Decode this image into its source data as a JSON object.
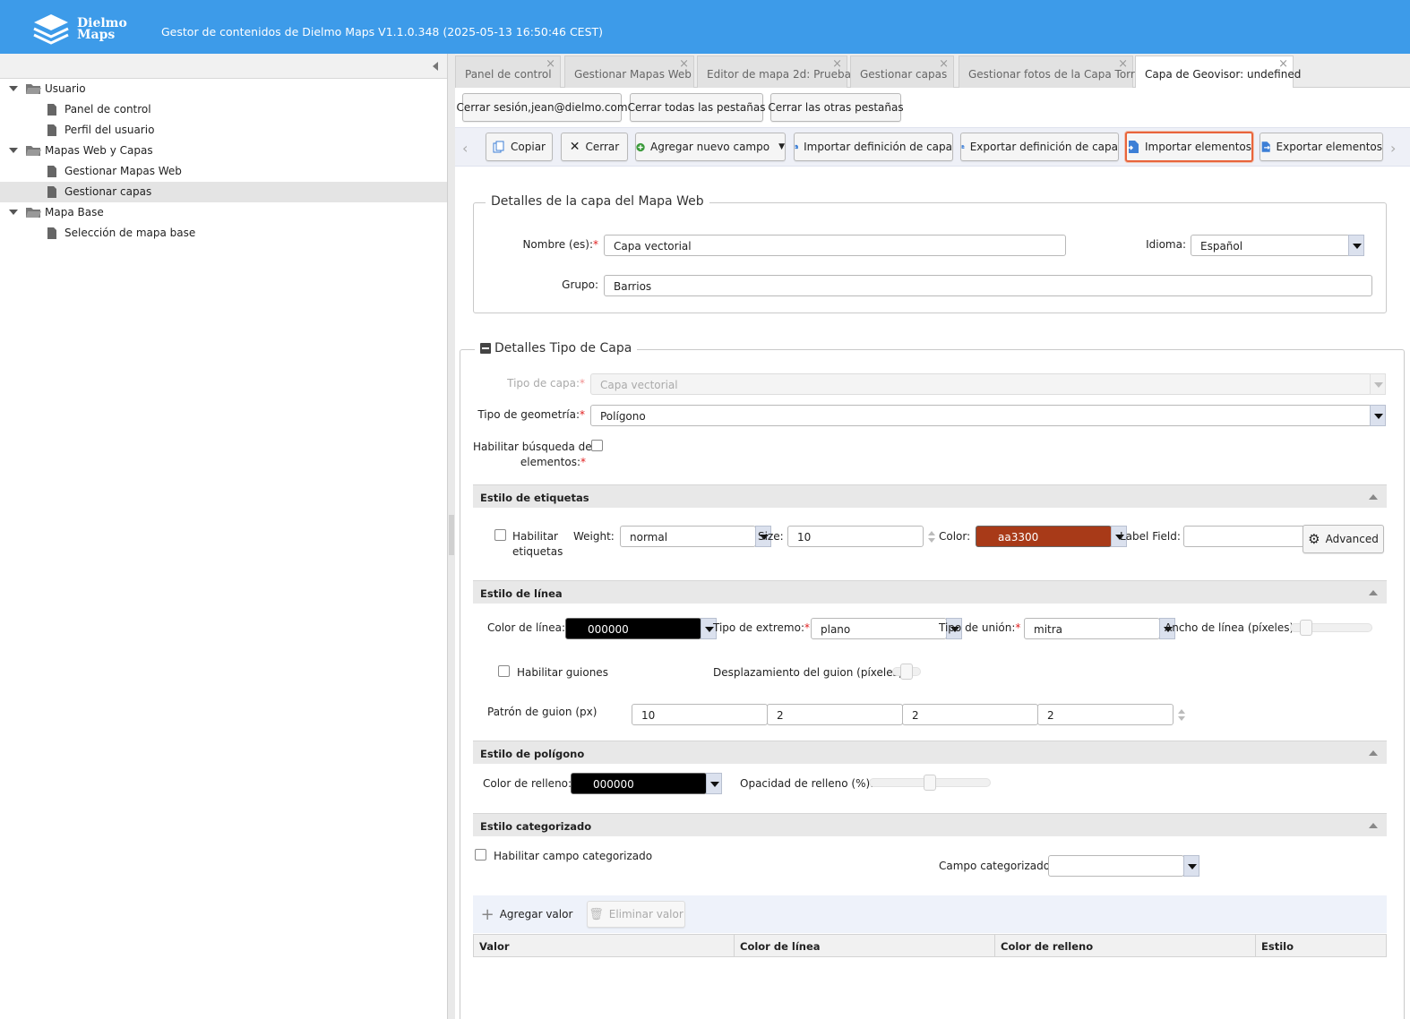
{
  "header": {
    "logo_line1": "Dielmo",
    "logo_line2": "Maps",
    "title": "Gestor de contenidos de Dielmo Maps V1.1.0.348 (2025-05-13 16:50:46 CEST)"
  },
  "tree": [
    {
      "label": "Usuario",
      "type": "folder"
    },
    {
      "label": "Panel de control",
      "type": "leaf"
    },
    {
      "label": "Perfil del usuario",
      "type": "leaf"
    },
    {
      "label": "Mapas Web y Capas",
      "type": "folder"
    },
    {
      "label": "Gestionar Mapas Web",
      "type": "leaf"
    },
    {
      "label": "Gestionar capas",
      "type": "leaf",
      "selected": true
    },
    {
      "label": "Mapa Base",
      "type": "folder"
    },
    {
      "label": "Selección de mapa base",
      "type": "leaf"
    }
  ],
  "tabs": [
    {
      "label": "Panel de control"
    },
    {
      "label": "Gestionar Mapas Web"
    },
    {
      "label": "Editor de mapa 2d: Prueba"
    },
    {
      "label": "Gestionar capas"
    },
    {
      "label": "Gestionar fotos de la Capa Torre"
    },
    {
      "label": "Capa de Geovisor: undefined",
      "active": true
    }
  ],
  "session_buttons": {
    "logout": "Cerrar sesión,jean@dielmo.com",
    "close_all": "Cerrar todas las pestañas",
    "close_others": "Cerrar las otras pestañas"
  },
  "actions": {
    "copy": "Copiar",
    "close": "Cerrar",
    "add_field": "Agregar nuevo campo",
    "import_def": "Importar definición de capa",
    "export_def": "Exportar definición de capa",
    "import_elements": "Importar elementos",
    "export_elements": "Exportar elementos"
  },
  "layer_details": {
    "legend": "Detalles de la capa del Mapa Web",
    "name_label": "Nombre (es):",
    "name_value": "Capa vectorial",
    "language_label": "Idioma:",
    "language_value": "Español",
    "group_label": "Grupo:",
    "group_value": "Barrios"
  },
  "type_details": {
    "legend": "Detalles Tipo de Capa",
    "layer_type_label": "Tipo de capa:",
    "layer_type_value": "Capa vectorial",
    "geometry_label": "Tipo de geometría:",
    "geometry_value": "Polígono",
    "search_label_1": "Habilitar búsqueda de",
    "search_label_2": "elementos:"
  },
  "label_style": {
    "title": "Estilo de etiquetas",
    "enable_1": "Habilitar",
    "enable_2": "etiquetas",
    "weight_label": "Weight:",
    "weight_value": "normal",
    "size_label": "Size:",
    "size_value": "10",
    "color_label": "Color:",
    "color_value": "aa3300",
    "color_hex": "#a83a18",
    "label_field_label": "Label Field:",
    "label_field_value": "",
    "advanced": "Advanced"
  },
  "line_style": {
    "title": "Estilo de línea",
    "color_label": "Color de línea:",
    "color_value": "000000",
    "end_label": "Tipo de extremo:",
    "end_value": "plano",
    "join_label": "Tipo de unión:",
    "join_value": "mitra",
    "width_label": "Ancho de línea (píxeles):",
    "dash_enable": "Habilitar guiones",
    "dash_offset_label": "Desplazamiento del guion (píxeles):",
    "pattern_label": "Patrón de guion (px)",
    "pattern_values": [
      "10",
      "2",
      "2",
      "2"
    ]
  },
  "polygon_style": {
    "title": "Estilo de polígono",
    "fill_label": "Color de relleno:",
    "fill_value": "000000",
    "opacity_label": "Opacidad de relleno (%):"
  },
  "category_style": {
    "title": "Estilo categorizado",
    "enable": "Habilitar campo categorizado",
    "field_label": "Campo categorizado:",
    "field_value": "",
    "add_value": "Agregar valor",
    "remove_value": "Eliminar valor",
    "columns": [
      "Valor",
      "Color de línea",
      "Color de relleno",
      "Estilo"
    ]
  }
}
